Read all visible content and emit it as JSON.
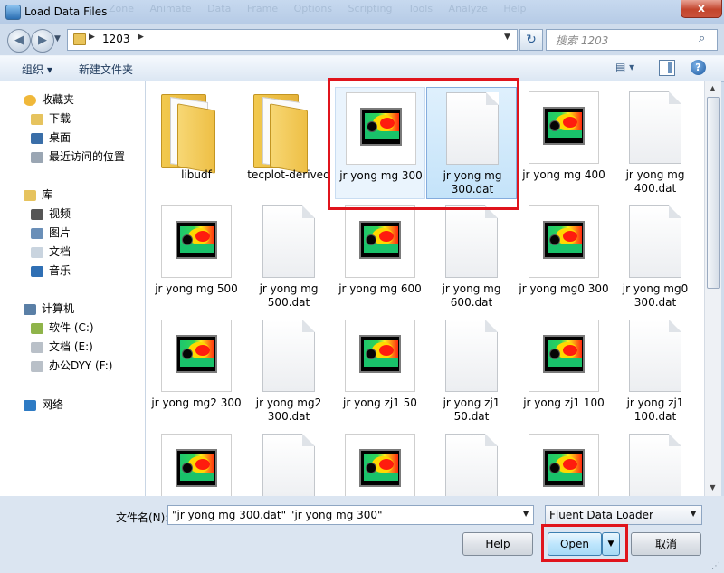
{
  "window": {
    "title": "Load Data Files",
    "close_glyph": "x",
    "ghost_menu": "Zone Animate Data Frame Options Scripting Tools Analyze Help"
  },
  "address": {
    "current_folder": "1203",
    "search_placeholder": "搜索 1203"
  },
  "toolbar": {
    "organize_label": "组织 ▾",
    "new_folder_label": "新建文件夹"
  },
  "sidebar": {
    "items": [
      {
        "label": "收藏夹",
        "icon": "star-icon"
      },
      {
        "label": "下载",
        "icon": "download-folder-icon"
      },
      {
        "label": "桌面",
        "icon": "desktop-icon"
      },
      {
        "label": "最近访问的位置",
        "icon": "recent-places-icon"
      },
      {
        "label": "库",
        "icon": "library-icon"
      },
      {
        "label": "视频",
        "icon": "video-icon"
      },
      {
        "label": "图片",
        "icon": "pictures-icon"
      },
      {
        "label": "文档",
        "icon": "documents-icon"
      },
      {
        "label": "音乐",
        "icon": "music-icon"
      },
      {
        "label": "计算机",
        "icon": "computer-icon"
      },
      {
        "label": "软件 (C:)",
        "icon": "drive-c-icon"
      },
      {
        "label": "文档 (E:)",
        "icon": "drive-e-icon"
      },
      {
        "label": "办公DYY (F:)",
        "icon": "drive-f-icon"
      },
      {
        "label": "网络",
        "icon": "network-icon"
      }
    ]
  },
  "files": [
    {
      "label": "libudf",
      "kind": "folder"
    },
    {
      "label": "tecplot-derived",
      "kind": "folder"
    },
    {
      "label": "jr yong mg 300",
      "kind": "plot",
      "state": "selected-hover"
    },
    {
      "label": "jr yong mg 300.dat",
      "kind": "doc",
      "state": "selected"
    },
    {
      "label": "jr yong mg 400",
      "kind": "plot"
    },
    {
      "label": "jr yong mg 400.dat",
      "kind": "doc"
    },
    {
      "label": "jr yong mg 500",
      "kind": "plot"
    },
    {
      "label": "jr yong mg 500.dat",
      "kind": "doc"
    },
    {
      "label": "jr yong mg 600",
      "kind": "plot"
    },
    {
      "label": "jr yong mg 600.dat",
      "kind": "doc"
    },
    {
      "label": "jr yong mg0 300",
      "kind": "plot"
    },
    {
      "label": "jr yong mg0 300.dat",
      "kind": "doc"
    },
    {
      "label": "jr yong mg2 300",
      "kind": "plot"
    },
    {
      "label": "jr yong mg2 300.dat",
      "kind": "doc"
    },
    {
      "label": "jr yong zj1 50",
      "kind": "plot"
    },
    {
      "label": "jr yong zj1 50.dat",
      "kind": "doc"
    },
    {
      "label": "jr yong zj1 100",
      "kind": "plot"
    },
    {
      "label": "jr yong zj1 100.dat",
      "kind": "doc"
    },
    {
      "label": "",
      "kind": "plot"
    },
    {
      "label": "",
      "kind": "doc"
    },
    {
      "label": "",
      "kind": "plot"
    },
    {
      "label": "",
      "kind": "doc"
    },
    {
      "label": "",
      "kind": "plot"
    },
    {
      "label": "",
      "kind": "doc"
    }
  ],
  "footer": {
    "filename_label": "文件名(N):",
    "filename_value": "\"jr yong mg 300.dat\" \"jr yong mg 300\"",
    "filter_value": "Fluent Data Loader",
    "help_label": "Help",
    "open_label": "Open",
    "cancel_label": "取消"
  },
  "colors": {
    "highlight_red": "#e0141c",
    "selection_blue": "#c4e3f9"
  }
}
